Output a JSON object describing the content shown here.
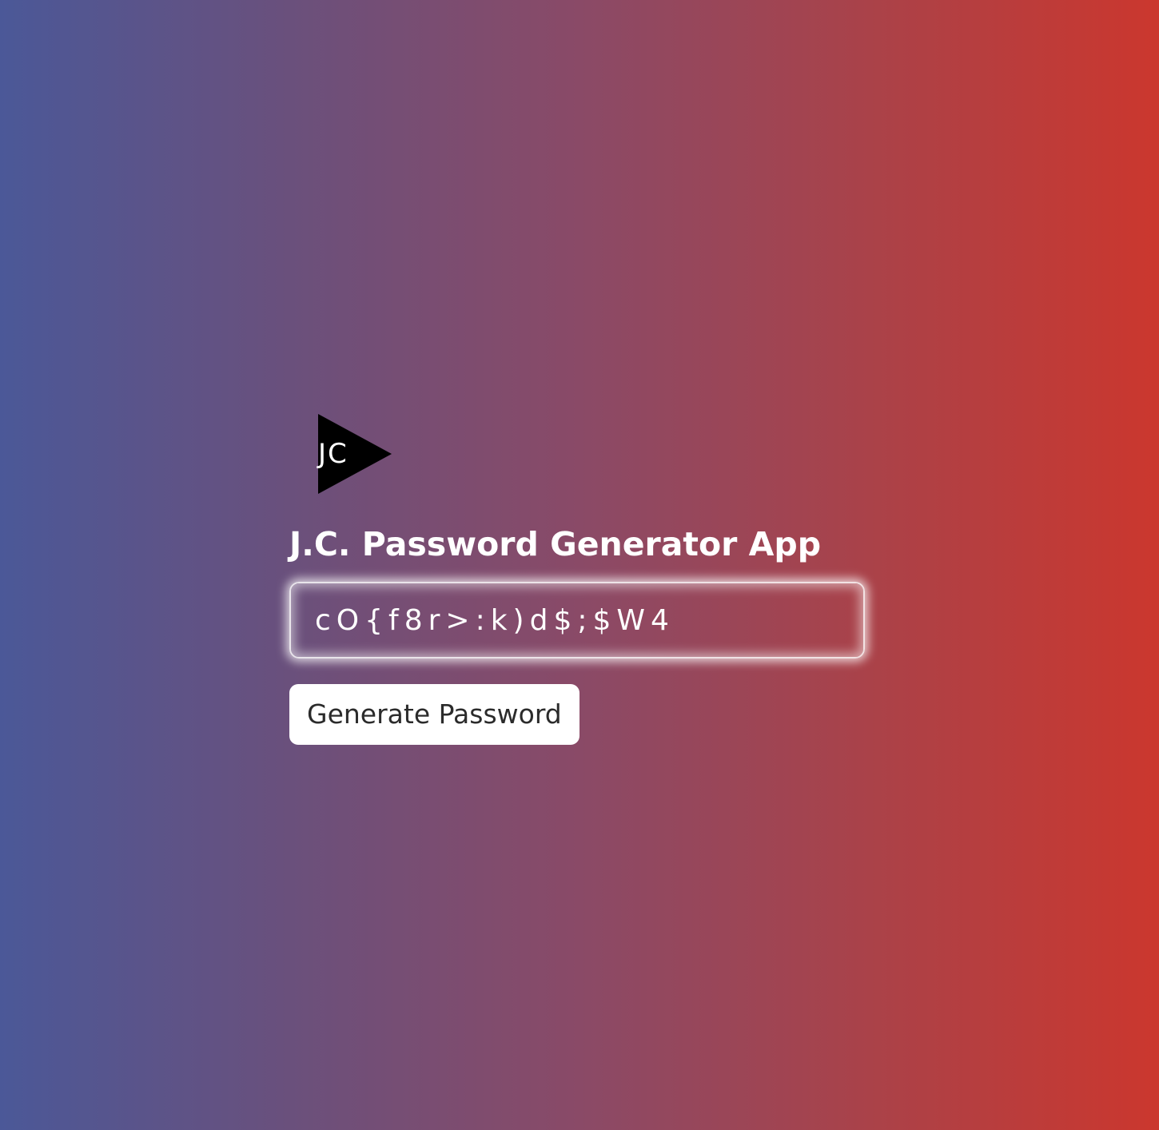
{
  "logo": {
    "icon": "jc-triangle-logo",
    "text": "JC"
  },
  "title": "J.C. Password Generator App",
  "password": {
    "value": "cO{f8r>:k)d$;$W4"
  },
  "generate_button": {
    "label": "Generate Password"
  },
  "colors": {
    "gradient_start": "#4b5898",
    "gradient_end": "#cb372e",
    "logo_fill": "#000000",
    "button_bg": "#ffffff",
    "button_text": "#2b2b2b"
  }
}
